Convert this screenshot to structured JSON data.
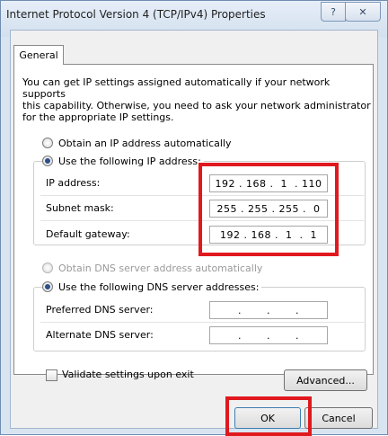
{
  "window": {
    "title": "Internet Protocol Version 4 (TCP/IPv4) Properties",
    "help_glyph": "?",
    "close_glyph": "✕"
  },
  "tabs": [
    {
      "label": "General",
      "selected": true
    }
  ],
  "description": {
    "line1": "You can get IP settings assigned automatically if your network supports",
    "line2": "this capability. Otherwise, you need to ask your network administrator",
    "line3": "for the appropriate IP settings."
  },
  "ip_section": {
    "auto_label": "Obtain an IP address automatically",
    "manual_label": "Use the following IP address:",
    "selected": "manual",
    "fields": [
      {
        "label": "IP address:",
        "value": "192 . 168 .  1  . 110"
      },
      {
        "label": "Subnet mask:",
        "value": "255 . 255 . 255 .  0"
      },
      {
        "label": "Default gateway:",
        "value": "192 . 168 .  1  .  1"
      }
    ]
  },
  "dns_section": {
    "auto_label": "Obtain DNS server address automatically",
    "manual_label": "Use the following DNS server addresses:",
    "selected": "manual",
    "fields": [
      {
        "label": "Preferred DNS server:",
        "value": ".       .       ."
      },
      {
        "label": "Alternate DNS server:",
        "value": ".       .       ."
      }
    ]
  },
  "validate": {
    "label": "Validate settings upon exit",
    "checked": false
  },
  "buttons": {
    "advanced": "Advanced...",
    "ok": "OK",
    "cancel": "Cancel"
  },
  "colors": {
    "highlight": "#e0191e",
    "title_bar": "#d9e4f1",
    "panel": "#ffffff"
  }
}
